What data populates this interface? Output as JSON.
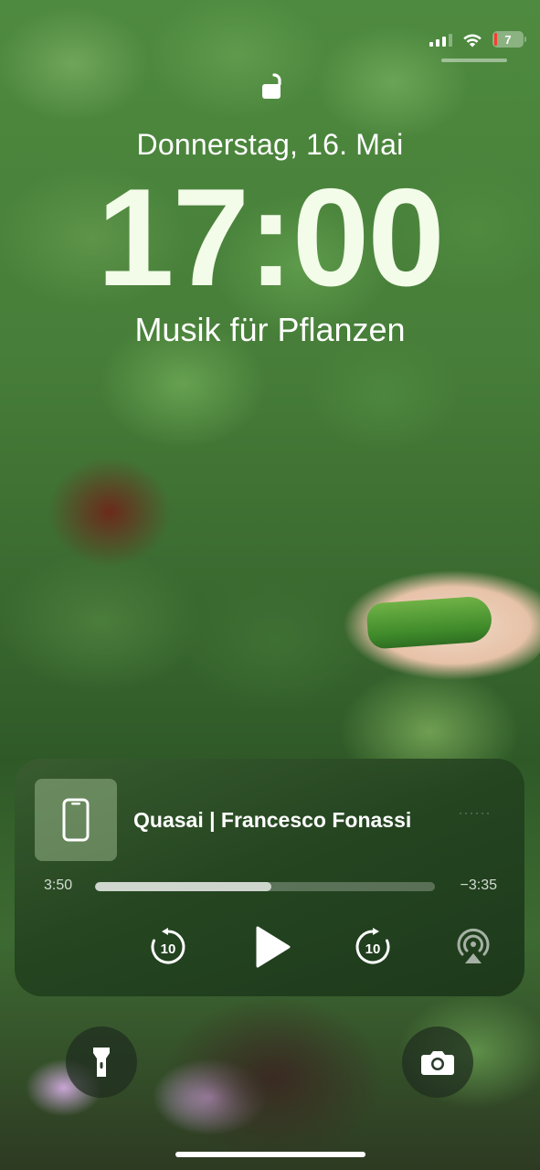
{
  "status_bar": {
    "battery_level": "7",
    "battery_color": "#ff3b30"
  },
  "lock_screen": {
    "date": "Donnerstag, 16. Mai",
    "time": "17:00",
    "subtitle": "Musik für Pflanzen"
  },
  "now_playing": {
    "title": "Quasai | Francesco Fonassi",
    "elapsed": "3:50",
    "remaining": "−3:35",
    "progress": 0.52,
    "skip_back_label": "10",
    "skip_forward_label": "10",
    "more_dots": "······",
    "icons": {
      "artwork": "phone-icon",
      "skip_back": "rewind-10-icon",
      "play": "play-icon",
      "skip_forward": "forward-10-icon",
      "airplay": "airplay-icon"
    }
  },
  "quick_actions": {
    "left": "flashlight-icon",
    "right": "camera-icon"
  }
}
